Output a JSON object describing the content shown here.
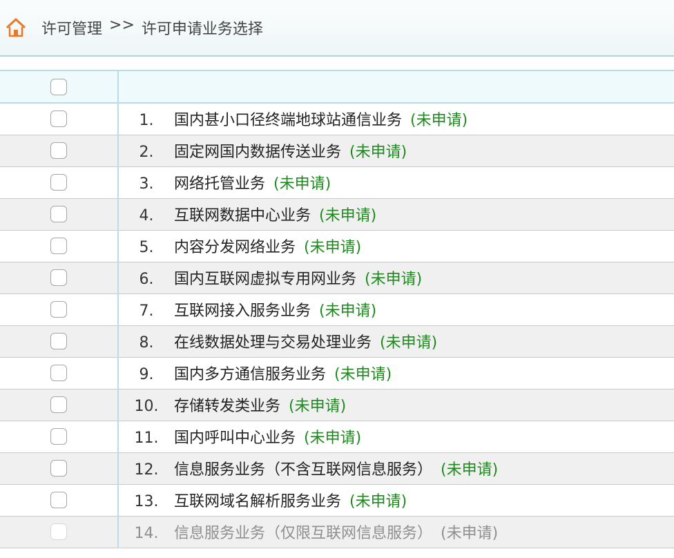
{
  "header": {
    "icon": "home-icon",
    "crumb_1": "许可管理",
    "separator": ">>",
    "crumb_2": "许可申请业务选择"
  },
  "colors": {
    "status_green": "#1e8a1e",
    "border_blue": "#a9d6e3",
    "disabled_gray": "#8f8f8f"
  },
  "rows": [
    {
      "num": "1.",
      "name": "国内甚小口径终端地球站通信业务",
      "status": "(未申请)",
      "disabled": false
    },
    {
      "num": "2.",
      "name": "固定网国内数据传送业务",
      "status": "(未申请)",
      "disabled": false
    },
    {
      "num": "3.",
      "name": "网络托管业务",
      "status": "(未申请)",
      "disabled": false
    },
    {
      "num": "4.",
      "name": "互联网数据中心业务",
      "status": "(未申请)",
      "disabled": false
    },
    {
      "num": "5.",
      "name": "内容分发网络业务",
      "status": "(未申请)",
      "disabled": false
    },
    {
      "num": "6.",
      "name": "国内互联网虚拟专用网业务",
      "status": "(未申请)",
      "disabled": false
    },
    {
      "num": "7.",
      "name": "互联网接入服务业务",
      "status": "(未申请)",
      "disabled": false
    },
    {
      "num": "8.",
      "name": "在线数据处理与交易处理业务",
      "status": "(未申请)",
      "disabled": false
    },
    {
      "num": "9.",
      "name": "国内多方通信服务业务",
      "status": "(未申请)",
      "disabled": false
    },
    {
      "num": "10.",
      "name": "存储转发类业务",
      "status": "(未申请)",
      "disabled": false
    },
    {
      "num": "11.",
      "name": "国内呼叫中心业务",
      "status": "(未申请)",
      "disabled": false
    },
    {
      "num": "12.",
      "name": "信息服务业务（不含互联网信息服务）",
      "status": "(未申请)",
      "disabled": false
    },
    {
      "num": "13.",
      "name": "互联网域名解析服务业务",
      "status": "(未申请)",
      "disabled": false
    },
    {
      "num": "14.",
      "name": "信息服务业务（仅限互联网信息服务）",
      "status": "(未申请)",
      "disabled": true
    }
  ]
}
